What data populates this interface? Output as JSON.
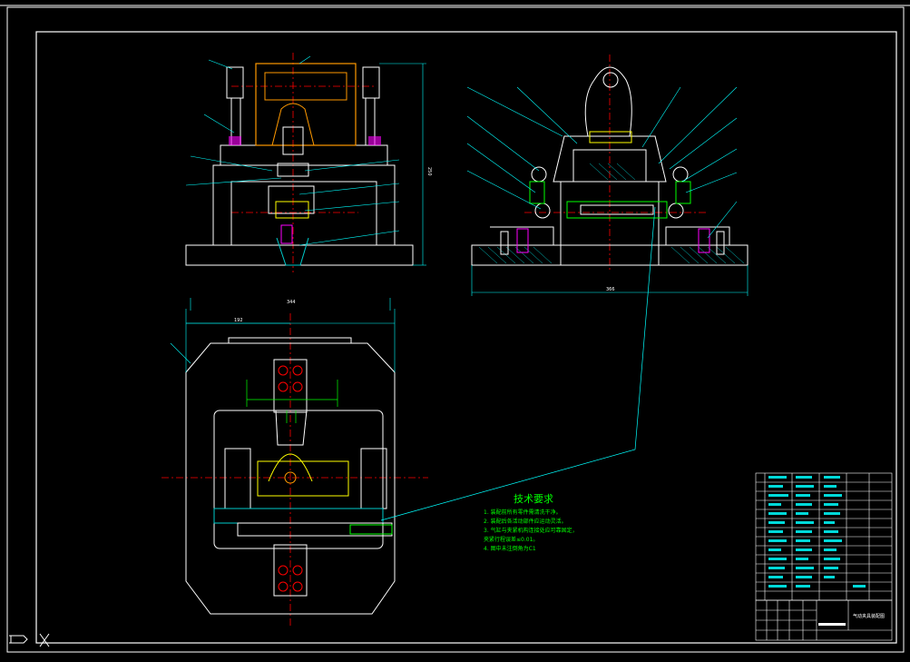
{
  "drawing": {
    "colors": {
      "background": "#000000",
      "outline": "#ffffff",
      "center_line": "#ff0000",
      "dimension": "#00ffff",
      "part_orange": "#ff9900",
      "part_yellow": "#ffff00",
      "annotation_green": "#00ff00",
      "hatch_cyan": "#00cccc",
      "accent_magenta": "#ff00ff"
    },
    "dimensions": {
      "front_view_height": "250",
      "side_view_width": "366",
      "top_view_width": "344",
      "top_view_offset": "192"
    },
    "technical_requirements": {
      "title": "技术要求",
      "items": [
        "1. 装配前所有零件需清洗干净。",
        "2. 装配后各活动部件应运动灵活。",
        "3. 气缸与夹紧机构连接处应可靠固定，",
        "   夹紧行程误差≤0.01。",
        "4. 图中未注倒角为C1"
      ]
    },
    "title_block": {
      "drawing_name": "气动夹具装配图"
    }
  }
}
